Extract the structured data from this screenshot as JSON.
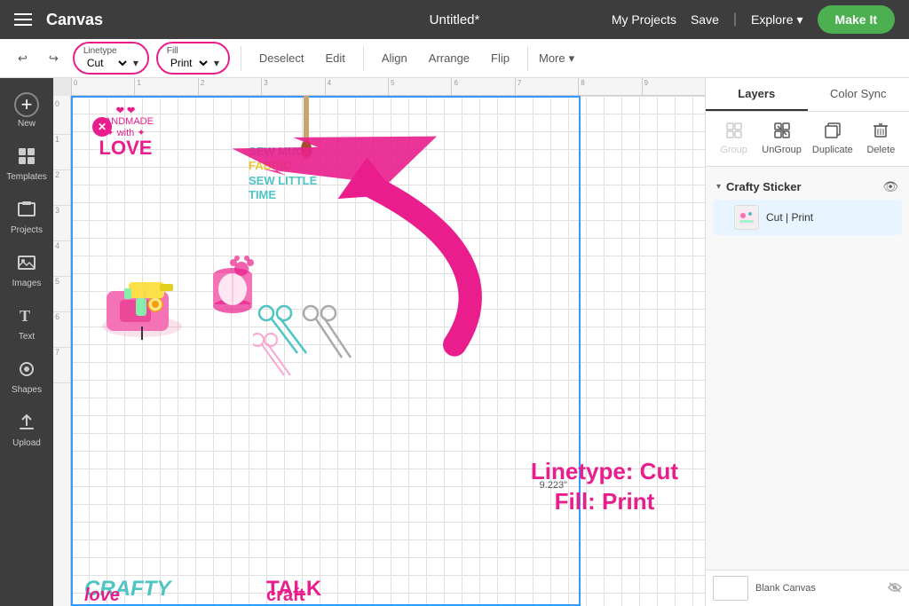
{
  "app": {
    "title": "Canvas",
    "doc_title": "Untitled*"
  },
  "nav": {
    "my_projects": "My Projects",
    "save": "Save",
    "explore": "Explore",
    "make_it": "Make It"
  },
  "toolbar": {
    "linetype_label": "Linetype",
    "linetype_value": "Cut",
    "fill_label": "Fill",
    "fill_value": "Print",
    "deselect": "Deselect",
    "edit": "Edit",
    "align": "Align",
    "arrange": "Arrange",
    "flip": "Flip",
    "more": "More"
  },
  "sidebar": {
    "items": [
      {
        "id": "new",
        "label": "New",
        "icon": "+"
      },
      {
        "id": "templates",
        "label": "Templates",
        "icon": "T"
      },
      {
        "id": "projects",
        "label": "Projects",
        "icon": "⊞"
      },
      {
        "id": "images",
        "label": "Images",
        "icon": "🖼"
      },
      {
        "id": "text",
        "label": "Text",
        "icon": "T"
      },
      {
        "id": "shapes",
        "label": "Shapes",
        "icon": "◎"
      },
      {
        "id": "upload",
        "label": "Upload",
        "icon": "↑"
      }
    ]
  },
  "right_panel": {
    "tabs": [
      {
        "id": "layers",
        "label": "Layers",
        "active": true
      },
      {
        "id": "color_sync",
        "label": "Color Sync",
        "active": false
      }
    ],
    "actions": [
      {
        "id": "group",
        "label": "Group",
        "icon": "⊞",
        "disabled": true
      },
      {
        "id": "ungroup",
        "label": "UnGroup",
        "icon": "⊟",
        "disabled": false
      },
      {
        "id": "duplicate",
        "label": "Duplicate",
        "icon": "⧉",
        "disabled": false
      },
      {
        "id": "delete",
        "label": "Delete",
        "icon": "🗑",
        "disabled": false
      }
    ],
    "layer_group": {
      "name": "Crafty Sticker",
      "visible": true,
      "item": {
        "name": "Cut | Print",
        "icon": "🖼"
      }
    },
    "bottom": {
      "label": "Blank Canvas",
      "visible": false
    }
  },
  "annotation": {
    "line1": "Linetype: Cut",
    "line2": "Fill: Print"
  },
  "canvas": {
    "dimension_label": "9.223\"",
    "close_btn": "✕"
  },
  "ruler": {
    "top": [
      "0",
      "1",
      "2",
      "3",
      "4",
      "5",
      "6",
      "7",
      "8",
      "9"
    ],
    "left": [
      "0",
      "1",
      "2",
      "3",
      "4",
      "5",
      "6",
      "7"
    ]
  }
}
